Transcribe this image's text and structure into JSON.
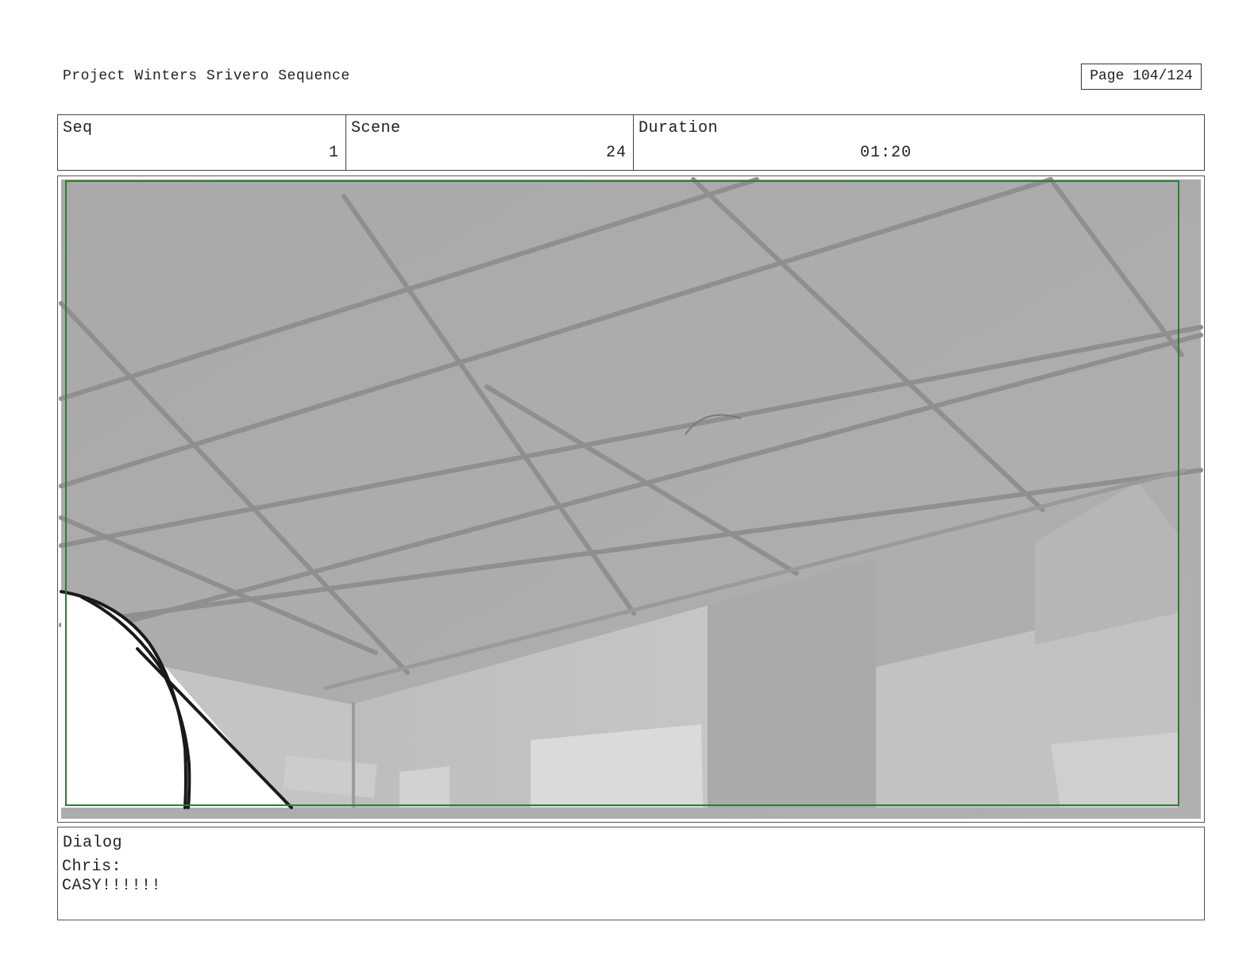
{
  "header": {
    "project_title": "Project Winters Srivero Sequence",
    "page_label": "Page 104/124"
  },
  "info": {
    "seq_label": "Seq",
    "seq_value": "1",
    "scene_label": "Scene",
    "scene_value": "24",
    "duration_label": "Duration",
    "duration_value": "01:20"
  },
  "dialog": {
    "label": "Dialog",
    "speaker": "Chris:",
    "line": "CASY!!!!!!"
  },
  "colors": {
    "safe_frame": "#2e7d32",
    "ceiling": "#a8a8a8",
    "grid_line": "#8e8e8e"
  }
}
